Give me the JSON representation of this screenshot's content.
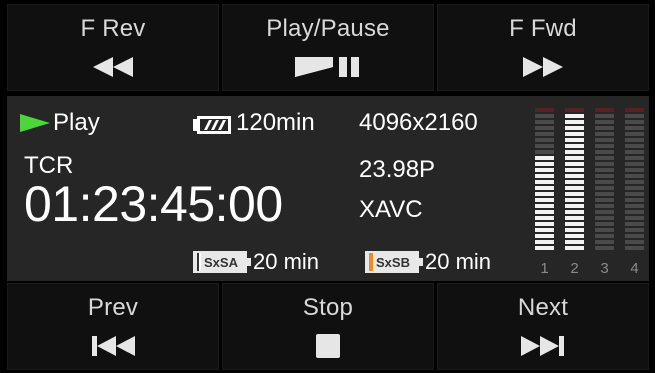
{
  "top_buttons": [
    {
      "label": "F Rev",
      "icon": "fast-rewind-icon"
    },
    {
      "label": "Play/Pause",
      "icon": "play-pause-icon"
    },
    {
      "label": "F Fwd",
      "icon": "fast-forward-icon"
    }
  ],
  "bottom_buttons": [
    {
      "label": "Prev",
      "icon": "skip-previous-icon"
    },
    {
      "label": "Stop",
      "icon": "stop-icon"
    },
    {
      "label": "Next",
      "icon": "skip-next-icon"
    }
  ],
  "status": {
    "state": "Play",
    "battery_time": "120min",
    "tc_label": "TCR",
    "timecode": "01:23:45:00",
    "resolution": "4096x2160",
    "frame_rate": "23.98P",
    "codec": "XAVC",
    "card_a": {
      "label": "SxSA",
      "remaining": "20 min",
      "color": "#ffffff"
    },
    "card_b": {
      "label": "SxSB",
      "remaining": "20 min",
      "color": "#f08a24"
    }
  },
  "meters": {
    "channels": [
      "1",
      "2",
      "3",
      "4"
    ],
    "levels": [
      0.68,
      0.96,
      0.0,
      0.0
    ]
  },
  "colors": {
    "play_green": "#4cd63c",
    "peak_red": "#e02020",
    "meter_on": "#f2f2f2",
    "meter_off": "#4a4a4a"
  }
}
